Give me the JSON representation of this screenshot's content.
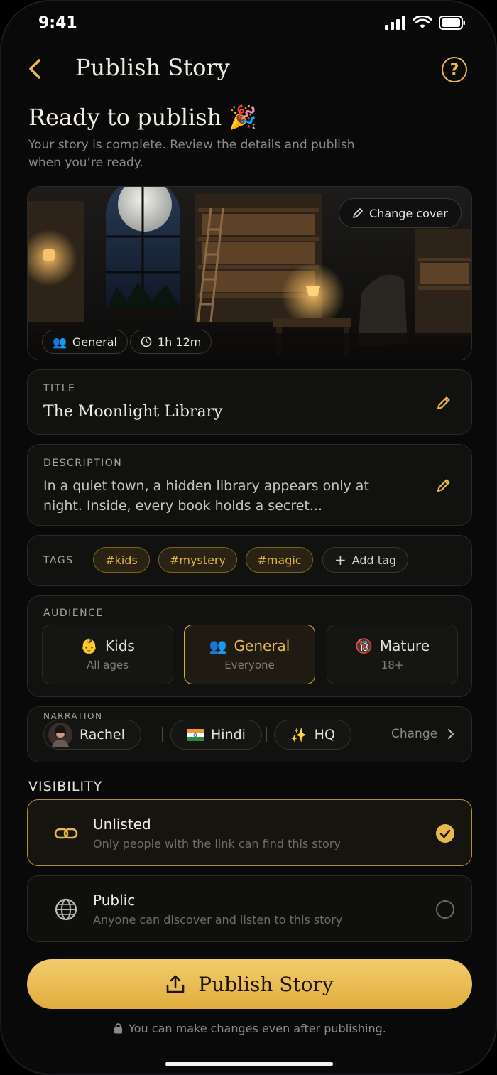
{
  "status": {
    "time": "9:41"
  },
  "header": {
    "title": "Publish Story",
    "help": "?"
  },
  "intro": {
    "title": "Ready to publish",
    "emoji": "🎉",
    "subtitle": "Your story is complete. Review the details and publish when you’re ready."
  },
  "cover": {
    "change_label": "Change cover",
    "audience_chip": "General",
    "duration_chip": "1h 12m"
  },
  "title_field": {
    "label": "TITLE",
    "value": "The Moonlight Library"
  },
  "description_field": {
    "label": "DESCRIPTION",
    "value": "In a quiet town, a hidden library appears only at night. Inside, every book holds a secret..."
  },
  "tags": {
    "label": "TAGS",
    "items": [
      "#kids",
      "#mystery",
      "#magic"
    ],
    "add_label": "Add tag"
  },
  "audience": {
    "label": "AUDIENCE",
    "options": [
      {
        "name": "Kids",
        "sub": "All ages",
        "icon": "baby-face-icon"
      },
      {
        "name": "General",
        "sub": "Everyone",
        "icon": "people-icon",
        "selected": true
      },
      {
        "name": "Mature",
        "sub": "18+",
        "icon": "no-under-18-icon"
      }
    ]
  },
  "narration": {
    "label": "NARRATION",
    "voice": "Rachel",
    "language": "Hindi",
    "quality": "HQ",
    "change_label": "Change"
  },
  "visibility": {
    "label": "VISIBILITY",
    "options": [
      {
        "title": "Unlisted",
        "sub": "Only people with the link can find this story",
        "selected": true
      },
      {
        "title": "Public",
        "sub": "Anyone can discover and listen to this story",
        "selected": false
      }
    ]
  },
  "publish": {
    "label": "Publish Story",
    "note": "You can make changes even after publishing."
  },
  "colors": {
    "accent": "#e7b94a",
    "background": "#09090a"
  }
}
